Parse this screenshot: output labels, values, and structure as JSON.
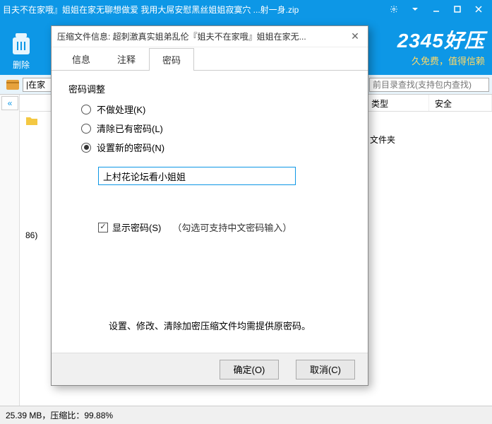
{
  "window": {
    "title": "目夫不在家哦』姐姐在家无聊想做爱 我用大屌安慰黑丝姐姐寂寞穴 ...射一身.zip"
  },
  "toolbar": {
    "delete_label": "删除",
    "brand": "2345好压",
    "brand_sub": "久免费，值得信赖"
  },
  "pathbar": {
    "path": "|在家",
    "search_placeholder": "前目录查找(支持包内查找)"
  },
  "columns": {
    "type": "类型",
    "security": "安全"
  },
  "files": {
    "row1_name": "86)",
    "row_type": "文件夹"
  },
  "statusbar": {
    "text": "25.39 MB，压缩比：99.88%"
  },
  "dialog": {
    "title": "压缩文件信息: 超刺激真实姐弟乱伦『姐夫不在家哦』姐姐在家无...",
    "tabs": {
      "info": "信息",
      "comment": "注释",
      "password": "密码"
    },
    "group_title": "密码调整",
    "radios": {
      "none": "不做处理(K)",
      "clear": "清除已有密码(L)",
      "set": "设置新的密码(N)"
    },
    "password_value": "上村花论坛看小姐姐",
    "show_password": "显示密码(S)",
    "show_password_hint": "（勾选可支持中文密码输入）",
    "note": "设置、修改、清除加密压缩文件均需提供原密码。",
    "ok_label": "确定(O)",
    "cancel_label": "取消(C)"
  }
}
